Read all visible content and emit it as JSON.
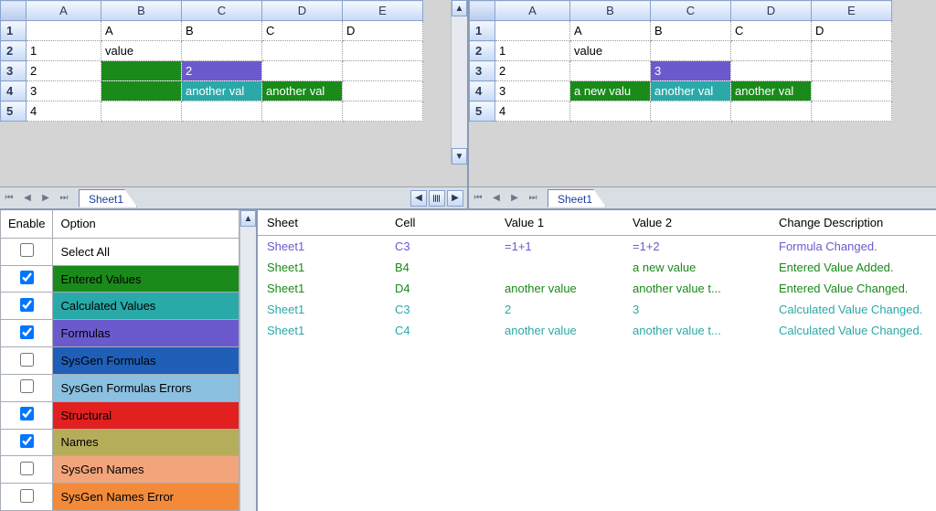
{
  "left_sheet": {
    "tab": "Sheet1",
    "col_headers": [
      "A",
      "B",
      "C",
      "D",
      "E"
    ],
    "row_headers": [
      "1",
      "2",
      "3",
      "4",
      "5"
    ],
    "rows": [
      {
        "A": "",
        "B": "A",
        "C": "B",
        "D": "C",
        "E": "D"
      },
      {
        "A": "1",
        "B": "value",
        "C": "",
        "D": "",
        "E": ""
      },
      {
        "A": "2",
        "B": "",
        "C": "2",
        "D": "",
        "E": ""
      },
      {
        "A": "3",
        "B": "",
        "C": "another val",
        "D": "another val",
        "E": ""
      },
      {
        "A": "4",
        "B": "",
        "C": "",
        "D": "",
        "E": ""
      }
    ],
    "highlights": [
      {
        "r": 2,
        "c": "B",
        "style": "green"
      },
      {
        "r": 2,
        "c": "C",
        "style": "purple"
      },
      {
        "r": 3,
        "c": "B",
        "style": "green"
      },
      {
        "r": 3,
        "c": "C",
        "style": "teal"
      },
      {
        "r": 3,
        "c": "D",
        "style": "green"
      }
    ]
  },
  "right_sheet": {
    "tab": "Sheet1",
    "col_headers": [
      "A",
      "B",
      "C",
      "D",
      "E"
    ],
    "row_headers": [
      "1",
      "2",
      "3",
      "4",
      "5"
    ],
    "rows": [
      {
        "A": "",
        "B": "A",
        "C": "B",
        "D": "C",
        "E": "D"
      },
      {
        "A": "1",
        "B": "value",
        "C": "",
        "D": "",
        "E": ""
      },
      {
        "A": "2",
        "B": "",
        "C": "3",
        "D": "",
        "E": ""
      },
      {
        "A": "3",
        "B": "a new valu",
        "C": "another val",
        "D": "another val",
        "E": ""
      },
      {
        "A": "4",
        "B": "",
        "C": "",
        "D": "",
        "E": ""
      }
    ],
    "highlights": [
      {
        "r": 2,
        "c": "C",
        "style": "purple"
      },
      {
        "r": 3,
        "c": "B",
        "style": "green"
      },
      {
        "r": 3,
        "c": "C",
        "style": "teal"
      },
      {
        "r": 3,
        "c": "D",
        "style": "green"
      }
    ]
  },
  "options": {
    "headers": {
      "enable": "Enable",
      "option": "Option"
    },
    "items": [
      {
        "label": "Select All",
        "checked": false,
        "class": "opt-white"
      },
      {
        "label": "Entered Values",
        "checked": true,
        "class": "opt-green"
      },
      {
        "label": "Calculated Values",
        "checked": true,
        "class": "opt-teal"
      },
      {
        "label": "Formulas",
        "checked": true,
        "class": "opt-purple"
      },
      {
        "label": "SysGen Formulas",
        "checked": false,
        "class": "opt-dblue"
      },
      {
        "label": "SysGen Formulas Errors",
        "checked": false,
        "class": "opt-lblue"
      },
      {
        "label": "Structural",
        "checked": true,
        "class": "opt-red"
      },
      {
        "label": "Names",
        "checked": true,
        "class": "opt-olive"
      },
      {
        "label": "SysGen Names",
        "checked": false,
        "class": "opt-salmon"
      },
      {
        "label": "SysGen Names Error",
        "checked": false,
        "class": "opt-orange"
      }
    ]
  },
  "changes": {
    "headers": {
      "sheet": "Sheet",
      "cell": "Cell",
      "v1": "Value 1",
      "v2": "Value 2",
      "desc": "Change Description"
    },
    "rows": [
      {
        "sheet": "Sheet1",
        "cell": "C3",
        "v1": "=1+1",
        "v2": "=1+2",
        "desc": "Formula Changed.",
        "class": "c-purple"
      },
      {
        "sheet": "Sheet1",
        "cell": "B4",
        "v1": "",
        "v2": "a new value",
        "desc": "Entered Value Added.",
        "class": "c-green"
      },
      {
        "sheet": "Sheet1",
        "cell": "D4",
        "v1": "another value",
        "v2": "another value t...",
        "desc": "Entered Value Changed.",
        "class": "c-green"
      },
      {
        "sheet": "Sheet1",
        "cell": "C3",
        "v1": "2",
        "v2": "3",
        "desc": "Calculated Value Changed.",
        "class": "c-teal"
      },
      {
        "sheet": "Sheet1",
        "cell": "C4",
        "v1": "another value",
        "v2": "another value t...",
        "desc": "Calculated Value Changed.",
        "class": "c-teal"
      }
    ]
  }
}
